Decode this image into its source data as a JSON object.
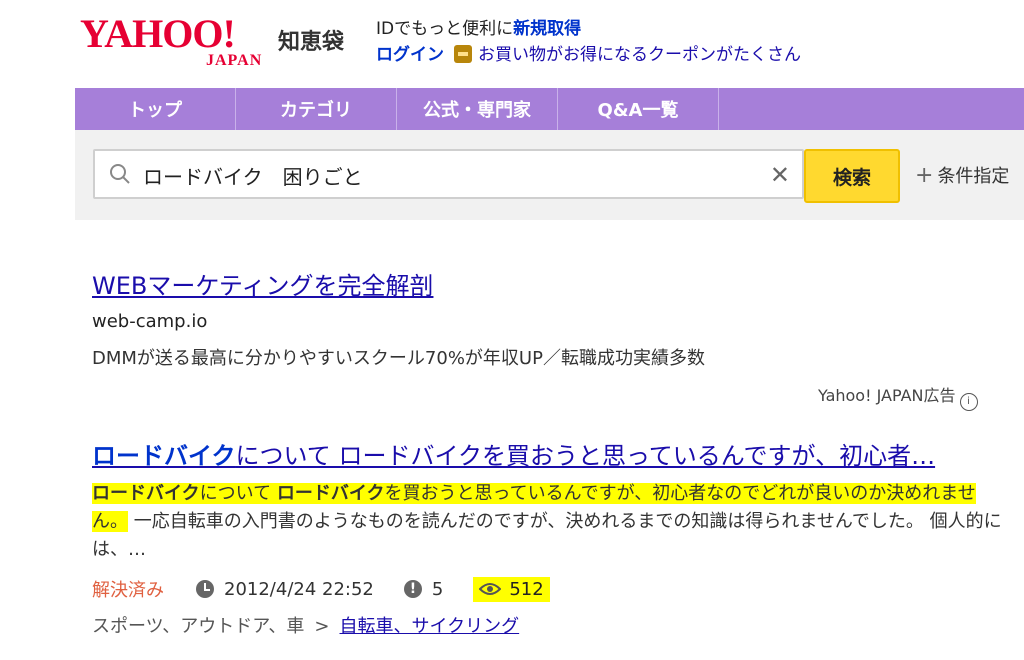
{
  "header": {
    "logo_main": "YAHOO!",
    "logo_sub": "JAPAN",
    "service_name": "知恵袋",
    "id_prompt": "IDでもっと便利に",
    "signup_label": "新規取得",
    "login_label": "ログイン",
    "coupon_text": "お買い物がお得になるクーポンがたくさん"
  },
  "nav": {
    "items": [
      "トップ",
      "カテゴリ",
      "公式・専門家",
      "Q&A一覧"
    ]
  },
  "search": {
    "query": "ロードバイク　困りごと",
    "button_label": "検索",
    "conditions_label": "条件指定"
  },
  "ad": {
    "title": "WEBマーケティングを完全解剖",
    "domain": "web-camp.io",
    "description": "DMMが送る最高に分かりやすいスクール70%が年収UP／転職成功実績多数",
    "label": "Yahoo! JAPAN広告"
  },
  "result": {
    "title_keyword": "ロードバイク",
    "title_rest": "について ロードバイクを買おうと思っているんですが、初心者…",
    "snippet": {
      "kw1": "ロードバイク",
      "part1": "について ",
      "kw2": "ロードバイク",
      "part2": "を買おうと思っているんですが、初心者なのでどれが良いのか決めれません。",
      "part3": " 一応自転車の入門書のようなものを読んだのですが、決めれるまでの知識は得られませんでした。 個人的には、…"
    },
    "status": "解決済み",
    "date": "2012/4/24 22:52",
    "answers": "5",
    "views": "512",
    "category_parent": "スポーツ、アウトドア、車",
    "category_separator": ">",
    "category_child": "自転車、サイクリング"
  },
  "colors": {
    "nav_bg": "#a67fd9",
    "search_button": "#ffd92f",
    "highlight": "#ffff00",
    "link": "#1a0dab",
    "brand_red": "#e60033"
  }
}
